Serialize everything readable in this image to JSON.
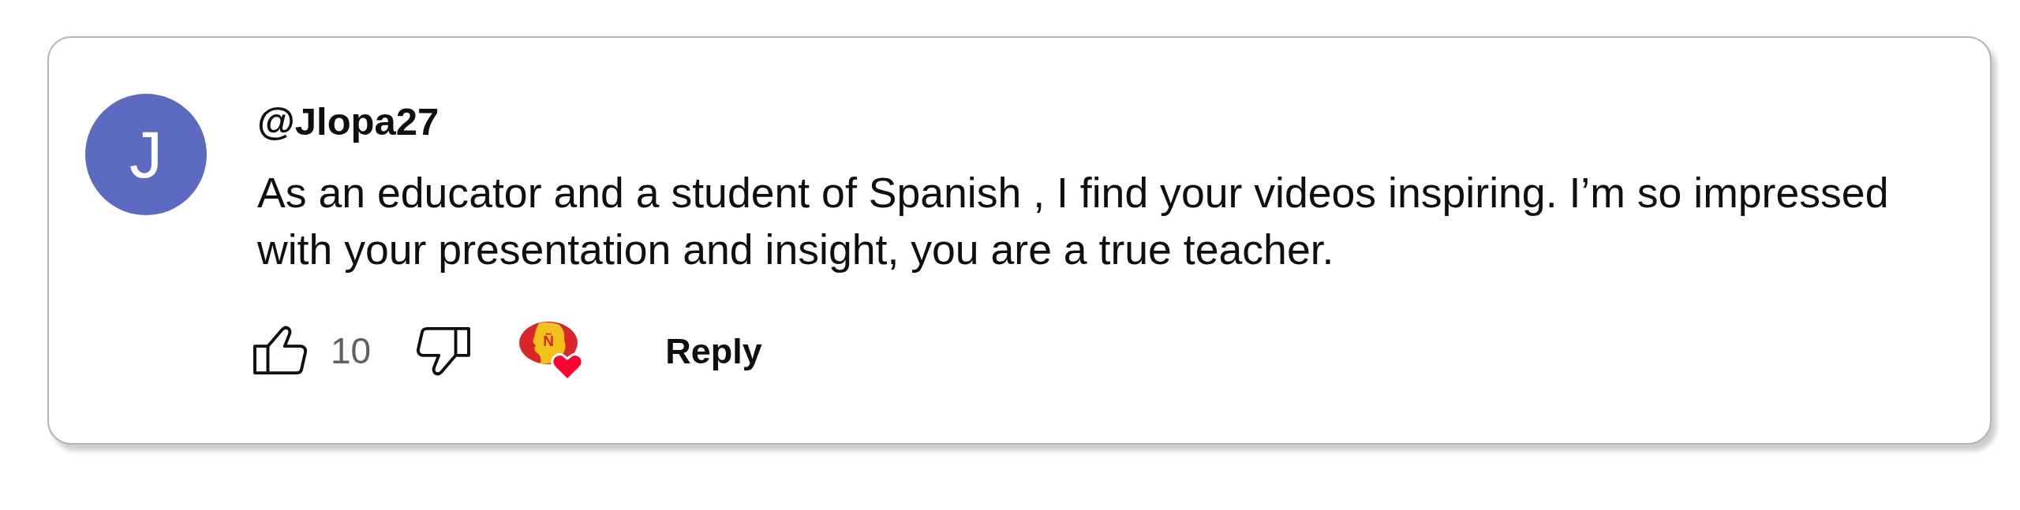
{
  "comment": {
    "avatar": {
      "letter": "J"
    },
    "author": "@Jlopa27",
    "text": "As an educator and a student of Spanish , I find your videos inspiring. I’m so impressed with your presentation and insight, you are a true teacher.",
    "likes": "10",
    "liked": false,
    "disliked": false,
    "creator_heart": {
      "hearted": true,
      "badge_letter": "Ñ"
    },
    "reply_label": "Reply"
  }
}
